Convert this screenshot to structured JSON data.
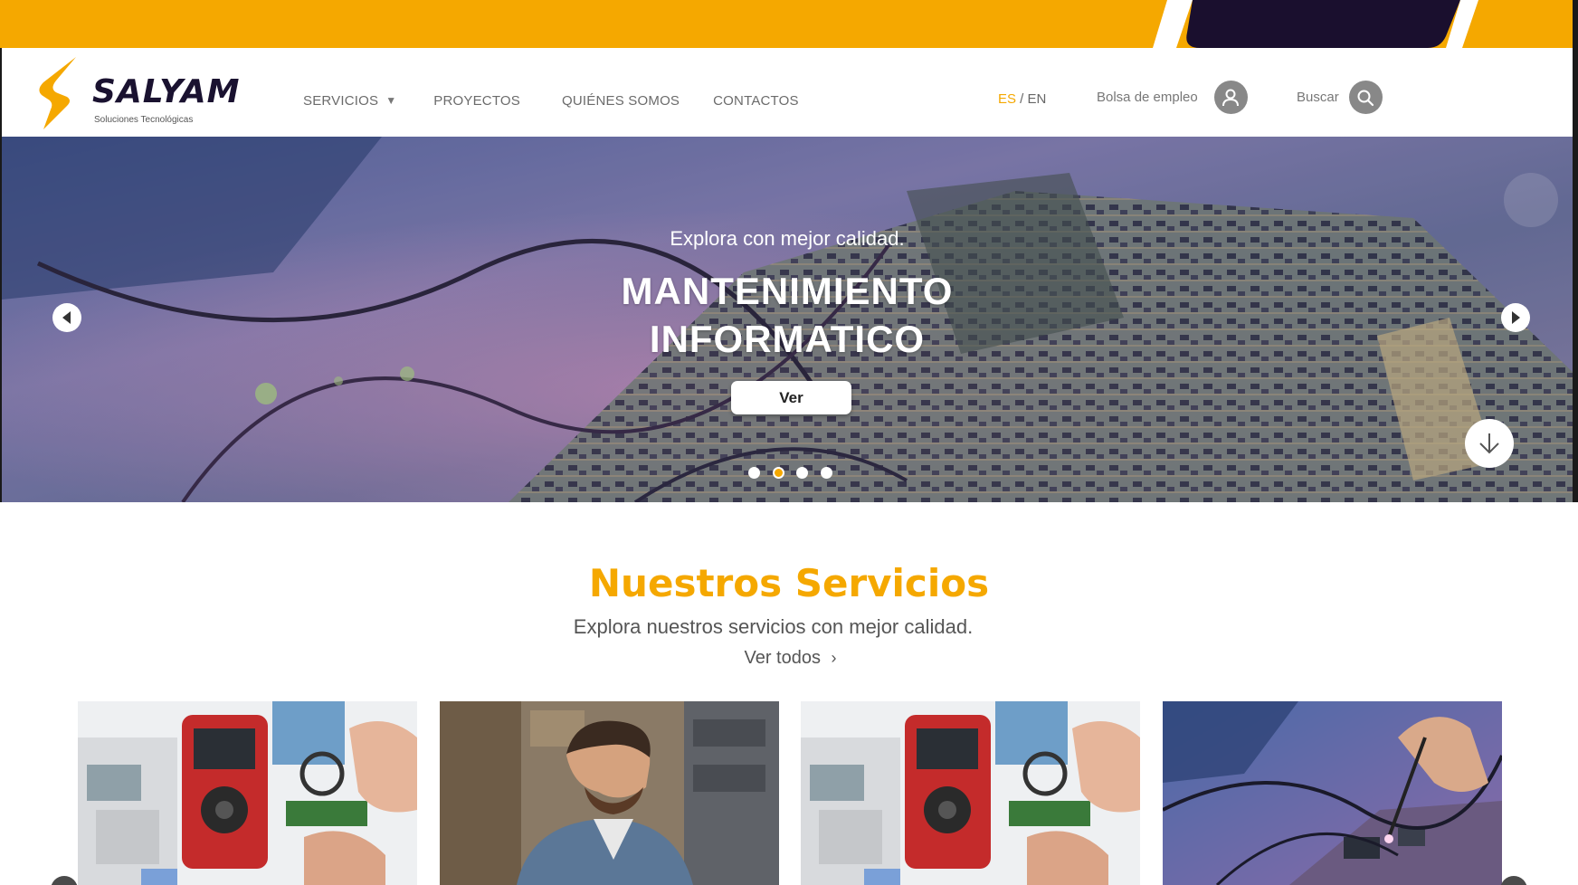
{
  "brand": {
    "name": "SALYAM",
    "tagline": "Soluciones Tecnológicas",
    "colors": {
      "accent": "#f5a800",
      "dark": "#1a1230"
    }
  },
  "nav": {
    "items": [
      {
        "label": "SERVICIOS",
        "has_dropdown": true
      },
      {
        "label": "PROYECTOS"
      },
      {
        "label": "QUIÉNES SOMOS"
      },
      {
        "label": "CONTACTOS"
      }
    ]
  },
  "lang": {
    "es": "ES",
    "separator": " / ",
    "en": "EN",
    "active": "ES"
  },
  "header_actions": {
    "jobs_label": "Bolsa de empleo",
    "jobs_icon": "user-icon",
    "search_label": "Buscar",
    "search_icon": "search-icon"
  },
  "hero": {
    "subtitle": "Explora con mejor calidad.",
    "title_line1": "MANTENIMIENTO",
    "title_line2": "INFORMATICO",
    "button_label": "Ver",
    "slide_count": 4,
    "active_slide": 2
  },
  "services": {
    "title": "Nuestros Servicios",
    "subtitle": "Explora nuestros servicios con mejor calidad.",
    "link_label": "Ver todos",
    "link_icon": "chevron-right-icon",
    "cards": [
      {
        "image": "electronics-repair-bench"
      },
      {
        "image": "technician-portrait"
      },
      {
        "image": "electronics-repair-bench"
      },
      {
        "image": "circuit-board-soldering"
      }
    ]
  }
}
